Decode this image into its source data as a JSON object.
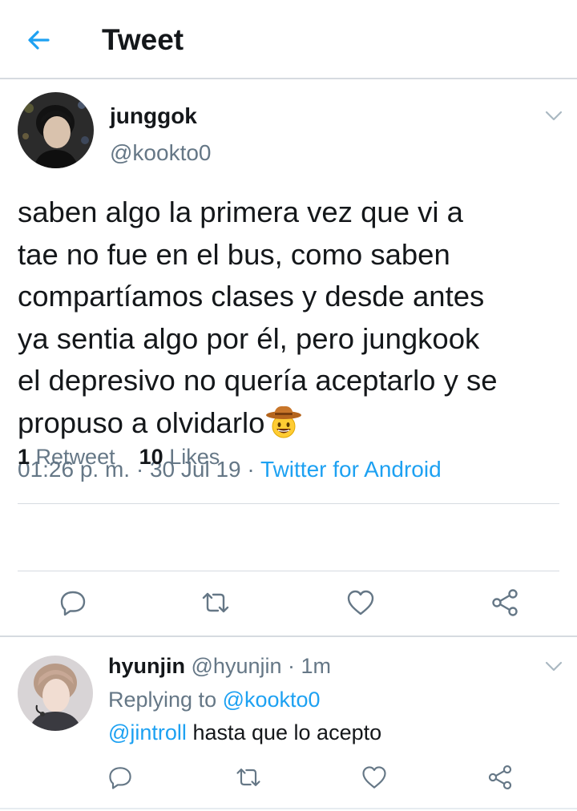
{
  "header": {
    "title": "Tweet"
  },
  "tweet": {
    "author_name": "junggok",
    "author_handle": "@kookto0",
    "text": "saben algo la primera vez que vi a\ntae no fue en el bus, como saben\ncompartíamos clases y desde antes\nya sentia algo por él, pero jungkook\nel depresivo no quería aceptarlo y se\npropuso a olvidarlo",
    "emoji": "cowboy-hat-face",
    "time": "01:26 p. m.",
    "date": "30 Jul 19",
    "separator": " · ",
    "source": "Twitter for Android",
    "retweet_count": "1",
    "retweet_label": "Retweet",
    "like_count": "10",
    "like_label": "Likes"
  },
  "reply": {
    "author_name": "hyunjin",
    "author_handle": "@hyunjin",
    "time": "1m",
    "dot": " · ",
    "replying_label": "Replying to ",
    "replying_handle": "@kookto0",
    "mention": "@jintroll",
    "text": " hasta que lo acepto"
  },
  "icons": {
    "back": "arrow-left-icon",
    "caret": "chevron-down-icon",
    "reply": "comment-icon",
    "retweet": "retweet-icon",
    "like": "heart-icon",
    "share": "share-icon"
  },
  "colors": {
    "accent": "#1da1f2",
    "secondary": "#657786",
    "text": "#14171a",
    "divider": "#d6dbe0"
  }
}
